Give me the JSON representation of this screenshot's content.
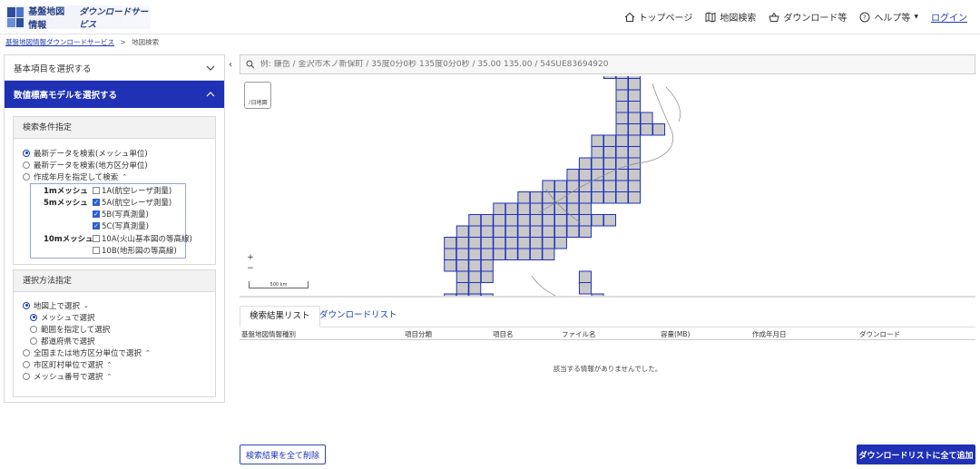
{
  "header": {
    "logo_title": "基盤地図情報",
    "logo_subtitle": "ダウンロードサービス",
    "nav": [
      {
        "label": "トップページ",
        "icon": "home-icon"
      },
      {
        "label": "地図検索",
        "icon": "map-icon"
      },
      {
        "label": "ダウンロード等",
        "icon": "basket-icon"
      },
      {
        "label": "ヘルプ等",
        "icon": "help-icon"
      }
    ],
    "login": "ログイン"
  },
  "breadcrumb": {
    "parent": "基盤地図情報ダウンロードサービス",
    "separator": ">",
    "current": "地図検索"
  },
  "sidebar": {
    "basic_items": "基本項目を選択する",
    "dem": "数値標高モデルを選択する",
    "conditions": {
      "title": "検索条件指定",
      "options": [
        "最新データを検索(メッシュ単位)",
        "最新データを検索(地方区分単位)",
        "作成年月を指定して検索"
      ],
      "selected": 0,
      "mesh": {
        "m1_label": "1mメッシュ",
        "m1_item": "1A(航空レーザ測量)",
        "m5_label": "5mメッシュ",
        "m5_items": [
          "5A(航空レーザ測量)",
          "5B(写真測量)",
          "5C(写真測量)"
        ],
        "m10_label": "10mメッシュ",
        "m10_items": [
          "10A(火山基本図の等高線)",
          "10B(地形図の等高線)"
        ]
      }
    },
    "method": {
      "title": "選択方法指定",
      "map_select": "地図上で選択",
      "sub_options": [
        "メッシュで選択",
        "範囲を指定して選択",
        "都道府県で選択"
      ],
      "region": "全国または地方区分単位で選択",
      "municipal": "市区町村単位で選択",
      "mesh_number": "メッシュ番号で選択"
    }
  },
  "search": {
    "placeholder": "例: 鎌岳 / 金沢市木ノ新保町 / 35度0分0秒 135度0分0秒 / 35.00 135.00 / 54SUE83694920"
  },
  "map": {
    "layer_label": "ﾉ日地図",
    "zoom_in": "+",
    "zoom_out": "−",
    "scale": "500 km"
  },
  "tabs": [
    "検索結果リスト",
    "ダウンロードリスト"
  ],
  "table": {
    "columns": [
      "基盤地図情報種別",
      "項目分類",
      "項目名",
      "ファイル名",
      "容量(MB)",
      "作成年月日",
      "ダウンロード"
    ],
    "empty": "該当する情報がありませんでした。"
  },
  "buttons": {
    "clear": "検索結果を全て削除",
    "add_all": "ダウンロードリストに全て追加"
  }
}
